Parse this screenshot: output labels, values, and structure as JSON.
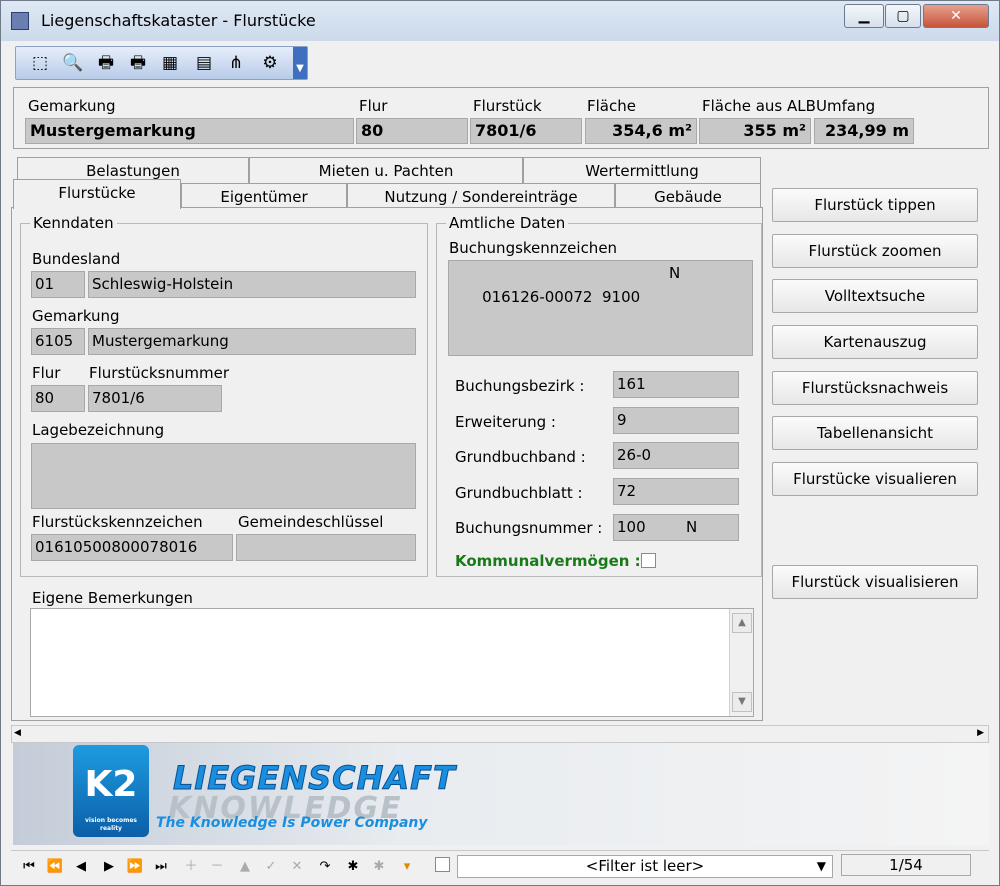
{
  "window": {
    "title": "Liegenschaftskataster - Flurstücke",
    "minimize": "▁",
    "maximize": "▢",
    "close": "✕"
  },
  "toolbar": {
    "icons": [
      "pointer-icon",
      "search-zoom-icon",
      "print-icon",
      "print-preview-icon",
      "table-icon",
      "export-icon",
      "hierarchy-icon",
      "settings-icon"
    ]
  },
  "header": {
    "gemarkung_label": "Gemarkung",
    "gemarkung": "Mustergemarkung",
    "flur_label": "Flur",
    "flur": "80",
    "flurstueck_label": "Flurstück",
    "flurstueck": "7801/6",
    "flaeche_label": "Fläche",
    "flaeche": "354,6 m²",
    "flaeche_alb_label": "Fläche aus ALB",
    "flaeche_alb": "355 m²",
    "umfang_label": "Umfang",
    "umfang": "234,99 m"
  },
  "tabs": {
    "row1": [
      "Belastungen",
      "Mieten u. Pachten",
      "Wertermittlung"
    ],
    "row2": [
      "Flurstücke",
      "Eigentümer",
      "Nutzung / Sondereinträge",
      "Gebäude"
    ]
  },
  "kenndaten": {
    "title": "Kenndaten",
    "bundesland_label": "Bundesland",
    "bundesland_code": "01",
    "bundesland": "Schleswig-Holstein",
    "gemarkung_label": "Gemarkung",
    "gemarkung_code": "6105",
    "gemarkung": "Mustergemarkung",
    "flur_label": "Flur",
    "flur": "80",
    "flurstuecksnummer_label": "Flurstücksnummer",
    "flurstuecksnummer": "7801/6",
    "lage_label": "Lagebezeichnung",
    "lage": "",
    "kennzeichen_label": "Flurstückskennzeichen",
    "kennzeichen": "01610500800078016",
    "gemeindeschluessel_label": "Gemeindeschlüssel",
    "gemeindeschluessel": ""
  },
  "amtlich": {
    "title": "Amtliche Daten",
    "buchungskennzeichen_label": "Buchungskennzeichen",
    "buchungskennzeichen": "016126-00072  9100",
    "buchungskennzeichen_flag": "N",
    "bezirk_label": "Buchungsbezirk :",
    "bezirk": "161",
    "erweiterung_label": "Erweiterung :",
    "erweiterung": "9",
    "band_label": "Grundbuchband :",
    "band": "26-0",
    "blatt_label": "Grundbuchblatt :",
    "blatt": "72",
    "nummer_label": "Buchungsnummer :",
    "nummer": "100",
    "nummer_flag": "N",
    "kommunal_label": "Kommunalvermögen :",
    "kommunal_color": "#1a7a1a"
  },
  "bemerkungen": {
    "title": "Eigene Bemerkungen",
    "text": ""
  },
  "actions": [
    "Flurstück tippen",
    "Flurstück zoomen",
    "Volltextsuche",
    "Kartenauszug",
    "Flurstücksnachweis",
    "Tabellenansicht",
    "Flurstücke visualieren",
    "Flurstück visualisieren"
  ],
  "banner": {
    "logo": "K2",
    "logo_tag": "vision becomes reality",
    "line1": "LIEGENSCHAFT",
    "line2": "KNOWLEDGE",
    "line3": "The Knowledge Is Power Company"
  },
  "nav": {
    "filter": "<Filter ist leer>",
    "record": "1/54"
  }
}
